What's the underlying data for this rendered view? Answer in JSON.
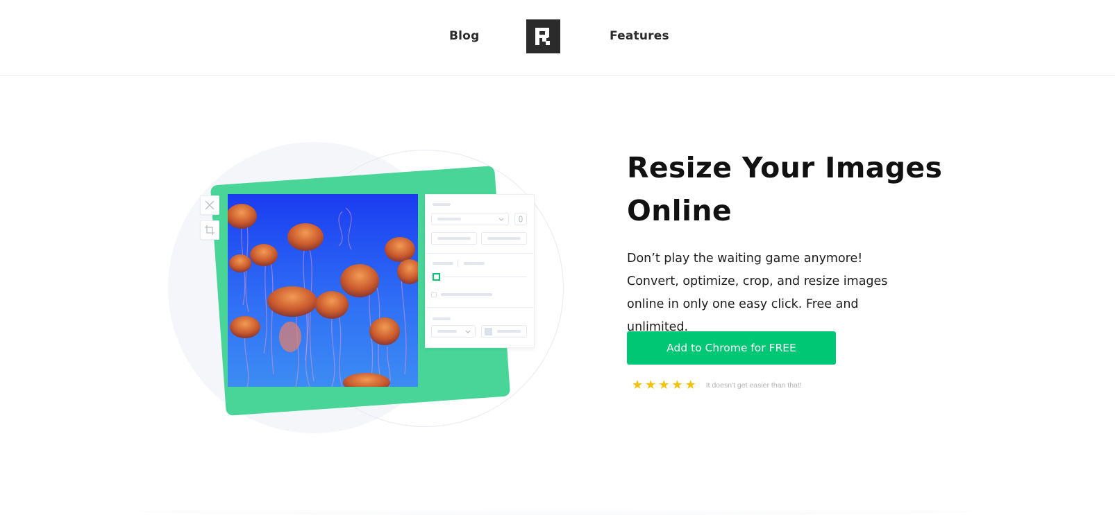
{
  "nav": {
    "blog_label": "Blog",
    "features_label": "Features",
    "logo_letter": "R"
  },
  "hero": {
    "title_line1": "Resize Your Images",
    "title_line2": "Online",
    "description": "Don’t play the waiting game anymore! Convert, optimize, crop, and resize images online in only one easy click. Free and unlimited.",
    "cta_label": "Add to Chrome for FREE",
    "rating_stars": 5,
    "rating_text": "It doesn't get easier than that!"
  },
  "illustration": {
    "image_subject": "jellyfish",
    "tools": [
      "close-icon",
      "crop-icon"
    ]
  },
  "colors": {
    "brand_green": "#00c774",
    "card_green": "#48d597",
    "star_yellow": "#f5c200",
    "logo_bg": "#2b2b2b"
  }
}
